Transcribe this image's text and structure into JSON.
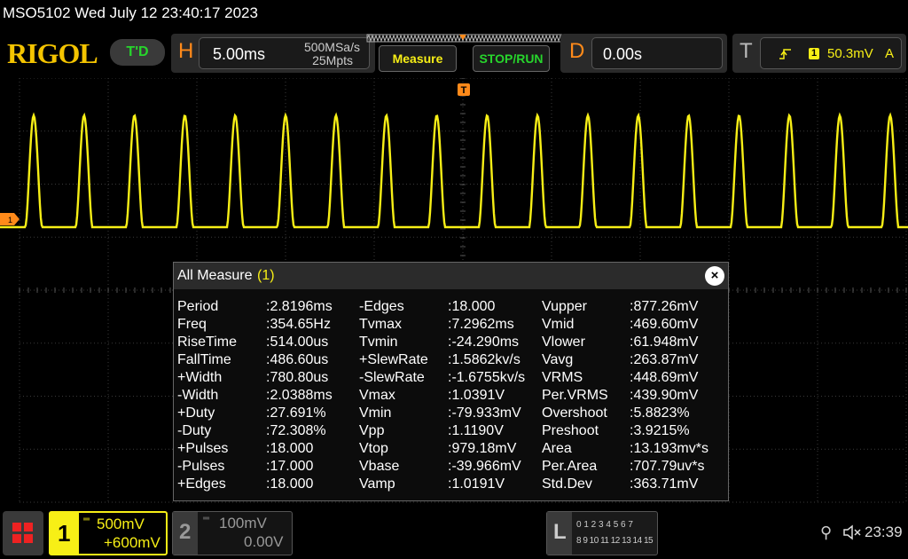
{
  "header": {
    "title": "MSO5102  Wed July 12 23:40:17 2023",
    "brand": "RIGOL",
    "trigger_mode": "T'D",
    "horizontal": {
      "label": "H",
      "timebase": "5.00ms",
      "sample_rate": "500MSa/s",
      "memory_depth": "25Mpts"
    },
    "measure_button": "Measure",
    "run_stop_button": "STOP/RUN",
    "delay": {
      "label": "D",
      "value": "0.00s"
    },
    "trigger": {
      "label": "T",
      "channel": "1",
      "level": "50.3mV",
      "coupling": "A"
    }
  },
  "scope": {
    "channel_marker": "1",
    "trigger_marker": "T",
    "waveform_color": "#f7ef16",
    "grid_color": "#3a3a3a",
    "cycles": 17
  },
  "measure": {
    "title": "All Measure",
    "channel_tag": "(1)",
    "close_icon": "×",
    "col1": [
      {
        "name": "Period",
        "value": ":2.8196ms"
      },
      {
        "name": "Freq",
        "value": ":354.65Hz"
      },
      {
        "name": "RiseTime",
        "value": ":514.00us"
      },
      {
        "name": "FallTime",
        "value": ":486.60us"
      },
      {
        "name": "+Width",
        "value": ":780.80us"
      },
      {
        "name": "-Width",
        "value": ":2.0388ms"
      },
      {
        "name": "+Duty",
        "value": ":27.691%"
      },
      {
        "name": "-Duty",
        "value": ":72.308%"
      },
      {
        "name": "+Pulses",
        "value": ":18.000"
      },
      {
        "name": "-Pulses",
        "value": ":17.000"
      },
      {
        "name": "+Edges",
        "value": ":18.000"
      }
    ],
    "col2": [
      {
        "name": "-Edges",
        "value": ":18.000"
      },
      {
        "name": "Tvmax",
        "value": ":7.2962ms"
      },
      {
        "name": "Tvmin",
        "value": ":-24.290ms"
      },
      {
        "name": "+SlewRate",
        "value": ":1.5862kv/s"
      },
      {
        "name": "-SlewRate",
        "value": ":-1.6755kv/s"
      },
      {
        "name": "Vmax",
        "value": ":1.0391V"
      },
      {
        "name": "Vmin",
        "value": ":-79.933mV"
      },
      {
        "name": "Vpp",
        "value": ":1.1190V"
      },
      {
        "name": "Vtop",
        "value": ":979.18mV"
      },
      {
        "name": "Vbase",
        "value": ":-39.966mV"
      },
      {
        "name": "Vamp",
        "value": ":1.0191V"
      }
    ],
    "col3": [
      {
        "name": "Vupper",
        "value": ":877.26mV"
      },
      {
        "name": "Vmid",
        "value": ":469.60mV"
      },
      {
        "name": "Vlower",
        "value": ":61.948mV"
      },
      {
        "name": "Vavg",
        "value": ":263.87mV"
      },
      {
        "name": "VRMS",
        "value": ":448.69mV"
      },
      {
        "name": "Per.VRMS",
        "value": ":439.90mV"
      },
      {
        "name": "Overshoot",
        "value": ":5.8823%"
      },
      {
        "name": "Preshoot",
        "value": ":3.9215%"
      },
      {
        "name": "Area",
        "value": ":13.193mv*s"
      },
      {
        "name": "Per.Area",
        "value": ":707.79uv*s"
      },
      {
        "name": "Std.Dev",
        "value": ":363.71mV"
      }
    ]
  },
  "footer": {
    "ch1": {
      "num": "1",
      "scale": "500mV",
      "offset": "+600mV"
    },
    "ch2": {
      "num": "2",
      "scale": "100mV",
      "offset": "0.00V"
    },
    "logic": {
      "label": "L",
      "row1": "0 1 2 3  4 5 6 7",
      "row2": "8 9 10 11 12 13 14 15"
    },
    "time": "23:39"
  }
}
